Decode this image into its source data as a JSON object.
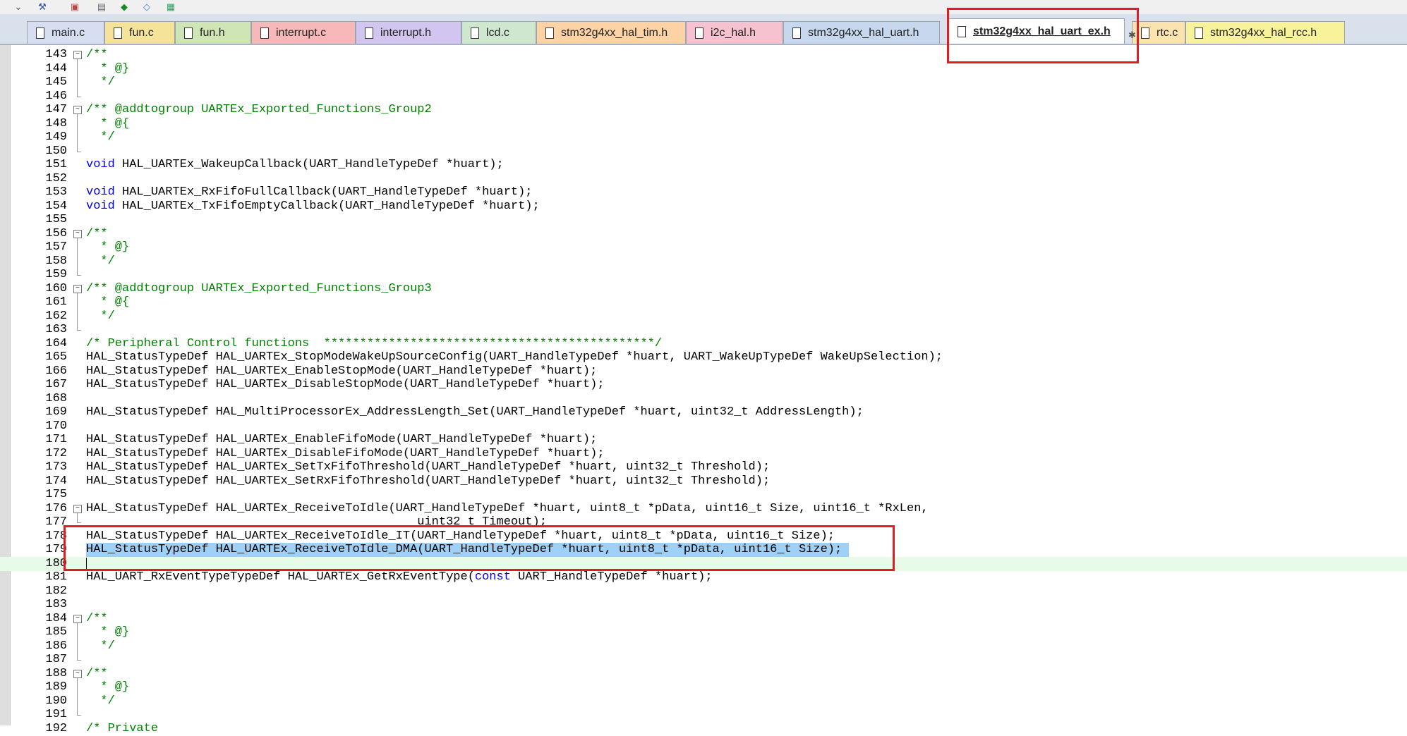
{
  "toolbar": {
    "items": [
      {
        "name": "dropdown-arrow-icon",
        "glyph": "⌄"
      },
      {
        "name": "build-tools-icon",
        "glyph": "⚒"
      },
      {
        "name": "manage-components-icon",
        "glyph": "▣"
      },
      {
        "name": "pack-installer-icon",
        "glyph": "▤"
      },
      {
        "name": "select-software-packs-icon",
        "glyph": "◆"
      },
      {
        "name": "diamond-icon",
        "glyph": "◇"
      },
      {
        "name": "window-icon",
        "glyph": "▦"
      }
    ]
  },
  "tabs": [
    {
      "label": "main.c",
      "color": "#d7def2",
      "active": false
    },
    {
      "label": "fun.c",
      "color": "#f6e39a",
      "active": false
    },
    {
      "label": "fun.h",
      "color": "#cfe5b6",
      "active": false
    },
    {
      "label": "interrupt.c",
      "color": "#f6b8b8",
      "active": false
    },
    {
      "label": "interrupt.h",
      "color": "#d2c6f0",
      "active": false
    },
    {
      "label": "lcd.c",
      "color": "#cfe6cf",
      "active": false
    },
    {
      "label": "stm32g4xx_hal_tim.h",
      "color": "#fdd3a6",
      "active": false
    },
    {
      "label": "i2c_hal.h",
      "color": "#f6c2cf",
      "active": false
    },
    {
      "label": "stm32g4xx_hal_uart.h",
      "color": "#c7d8ee",
      "active": false
    },
    {
      "label": "stm32g4xx_hal_uart_ex.h",
      "color": "#ffffff",
      "active": true
    },
    {
      "label": "rtc.c",
      "color": "#fbe3b0",
      "active": false
    },
    {
      "label": "stm32g4xx_hal_rcc.h",
      "color": "#f8f39a",
      "active": false
    }
  ],
  "colors": {
    "comment": "#008000",
    "keyword": "#0000ff",
    "selection": "#9fd1f7",
    "current_line": "#e8fbe9",
    "highlight_box": "#e01c24"
  },
  "editor": {
    "lines": [
      {
        "n": "143",
        "fold": "start",
        "segs": [
          {
            "t": "/**",
            "c": "cm"
          }
        ]
      },
      {
        "n": "144",
        "fold": "line",
        "segs": [
          {
            "t": "  * @}",
            "c": "cm"
          }
        ]
      },
      {
        "n": "145",
        "fold": "line",
        "segs": [
          {
            "t": "  */",
            "c": "cm"
          }
        ]
      },
      {
        "n": "146",
        "fold": "end",
        "segs": []
      },
      {
        "n": "147",
        "fold": "start",
        "segs": [
          {
            "t": "/** @addtogroup UARTEx_Exported_Functions_Group2",
            "c": "cm"
          }
        ]
      },
      {
        "n": "148",
        "fold": "line",
        "segs": [
          {
            "t": "  * @{",
            "c": "cm"
          }
        ]
      },
      {
        "n": "149",
        "fold": "line",
        "segs": [
          {
            "t": "  */",
            "c": "cm"
          }
        ]
      },
      {
        "n": "150",
        "fold": "end",
        "segs": []
      },
      {
        "n": "151",
        "fold": "",
        "segs": [
          {
            "t": "void",
            "c": "kw"
          },
          {
            "t": " HAL_UARTEx_WakeupCallback(UART_HandleTypeDef *huart);",
            "c": ""
          }
        ]
      },
      {
        "n": "152",
        "fold": "",
        "segs": []
      },
      {
        "n": "153",
        "fold": "",
        "segs": [
          {
            "t": "void",
            "c": "kw"
          },
          {
            "t": " HAL_UARTEx_RxFifoFullCallback(UART_HandleTypeDef *huart);",
            "c": ""
          }
        ]
      },
      {
        "n": "154",
        "fold": "",
        "segs": [
          {
            "t": "void",
            "c": "kw"
          },
          {
            "t": " HAL_UARTEx_TxFifoEmptyCallback(UART_HandleTypeDef *huart);",
            "c": ""
          }
        ]
      },
      {
        "n": "155",
        "fold": "",
        "segs": []
      },
      {
        "n": "156",
        "fold": "start",
        "segs": [
          {
            "t": "/**",
            "c": "cm"
          }
        ]
      },
      {
        "n": "157",
        "fold": "line",
        "segs": [
          {
            "t": "  * @}",
            "c": "cm"
          }
        ]
      },
      {
        "n": "158",
        "fold": "line",
        "segs": [
          {
            "t": "  */",
            "c": "cm"
          }
        ]
      },
      {
        "n": "159",
        "fold": "end",
        "segs": []
      },
      {
        "n": "160",
        "fold": "start",
        "segs": [
          {
            "t": "/** @addtogroup UARTEx_Exported_Functions_Group3",
            "c": "cm"
          }
        ]
      },
      {
        "n": "161",
        "fold": "line",
        "segs": [
          {
            "t": "  * @{",
            "c": "cm"
          }
        ]
      },
      {
        "n": "162",
        "fold": "line",
        "segs": [
          {
            "t": "  */",
            "c": "cm"
          }
        ]
      },
      {
        "n": "163",
        "fold": "end",
        "segs": []
      },
      {
        "n": "164",
        "fold": "",
        "segs": [
          {
            "t": "/* Peripheral Control functions  **********************************************/",
            "c": "cm"
          }
        ]
      },
      {
        "n": "165",
        "fold": "",
        "segs": [
          {
            "t": "HAL_StatusTypeDef HAL_UARTEx_StopModeWakeUpSourceConfig(UART_HandleTypeDef *huart, UART_WakeUpTypeDef WakeUpSelection);",
            "c": ""
          }
        ]
      },
      {
        "n": "166",
        "fold": "",
        "segs": [
          {
            "t": "HAL_StatusTypeDef HAL_UARTEx_EnableStopMode(UART_HandleTypeDef *huart);",
            "c": ""
          }
        ]
      },
      {
        "n": "167",
        "fold": "",
        "segs": [
          {
            "t": "HAL_StatusTypeDef HAL_UARTEx_DisableStopMode(UART_HandleTypeDef *huart);",
            "c": ""
          }
        ]
      },
      {
        "n": "168",
        "fold": "",
        "segs": []
      },
      {
        "n": "169",
        "fold": "",
        "segs": [
          {
            "t": "HAL_StatusTypeDef HAL_MultiProcessorEx_AddressLength_Set(UART_HandleTypeDef *huart, uint32_t AddressLength);",
            "c": ""
          }
        ]
      },
      {
        "n": "170",
        "fold": "",
        "segs": []
      },
      {
        "n": "171",
        "fold": "",
        "segs": [
          {
            "t": "HAL_StatusTypeDef HAL_UARTEx_EnableFifoMode(UART_HandleTypeDef *huart);",
            "c": ""
          }
        ]
      },
      {
        "n": "172",
        "fold": "",
        "segs": [
          {
            "t": "HAL_StatusTypeDef HAL_UARTEx_DisableFifoMode(UART_HandleTypeDef *huart);",
            "c": ""
          }
        ]
      },
      {
        "n": "173",
        "fold": "",
        "segs": [
          {
            "t": "HAL_StatusTypeDef HAL_UARTEx_SetTxFifoThreshold(UART_HandleTypeDef *huart, uint32_t Threshold);",
            "c": ""
          }
        ]
      },
      {
        "n": "174",
        "fold": "",
        "segs": [
          {
            "t": "HAL_StatusTypeDef HAL_UARTEx_SetRxFifoThreshold(UART_HandleTypeDef *huart, uint32_t Threshold);",
            "c": ""
          }
        ]
      },
      {
        "n": "175",
        "fold": "",
        "segs": []
      },
      {
        "n": "176",
        "fold": "start",
        "segs": [
          {
            "t": "HAL_StatusTypeDef HAL_UARTEx_ReceiveToIdle(UART_HandleTypeDef *huart, uint8_t *pData, uint16_t Size, uint16_t *RxLen,",
            "c": ""
          }
        ]
      },
      {
        "n": "177",
        "fold": "end",
        "segs": [
          {
            "t": "                                              uint32_t Timeout);",
            "c": ""
          }
        ]
      },
      {
        "n": "178",
        "fold": "",
        "segs": [
          {
            "t": "HAL_StatusTypeDef HAL_UARTEx_ReceiveToIdle_IT(UART_HandleTypeDef *huart, uint8_t *pData, uint16_t Size);",
            "c": ""
          }
        ]
      },
      {
        "n": "179",
        "fold": "",
        "sel": true,
        "segs": [
          {
            "t": "HAL_StatusTypeDef HAL_UARTEx_ReceiveToIdle_DMA(UART_HandleTypeDef *huart, uint8_t *pData, uint16_t Size); ",
            "c": ""
          }
        ]
      },
      {
        "n": "180",
        "fold": "",
        "current": true,
        "segs": []
      },
      {
        "n": "181",
        "fold": "",
        "segs": [
          {
            "t": "HAL_UART_RxEventTypeTypeDef HAL_UARTEx_GetRxEventType(",
            "c": ""
          },
          {
            "t": "const",
            "c": "kw"
          },
          {
            "t": " UART_HandleTypeDef *huart);",
            "c": ""
          }
        ]
      },
      {
        "n": "182",
        "fold": "",
        "segs": []
      },
      {
        "n": "183",
        "fold": "",
        "segs": []
      },
      {
        "n": "184",
        "fold": "start",
        "segs": [
          {
            "t": "/**",
            "c": "cm"
          }
        ]
      },
      {
        "n": "185",
        "fold": "line",
        "segs": [
          {
            "t": "  * @}",
            "c": "cm"
          }
        ]
      },
      {
        "n": "186",
        "fold": "line",
        "segs": [
          {
            "t": "  */",
            "c": "cm"
          }
        ]
      },
      {
        "n": "187",
        "fold": "end",
        "segs": []
      },
      {
        "n": "188",
        "fold": "start",
        "segs": [
          {
            "t": "/**",
            "c": "cm"
          }
        ]
      },
      {
        "n": "189",
        "fold": "line",
        "segs": [
          {
            "t": "  * @}",
            "c": "cm"
          }
        ]
      },
      {
        "n": "190",
        "fold": "line",
        "segs": [
          {
            "t": "  */",
            "c": "cm"
          }
        ]
      },
      {
        "n": "191",
        "fold": "end",
        "segs": []
      },
      {
        "n": "192",
        "fold": "",
        "segs": [
          {
            "t": "/* Private ",
            "c": "cm"
          }
        ]
      }
    ]
  }
}
